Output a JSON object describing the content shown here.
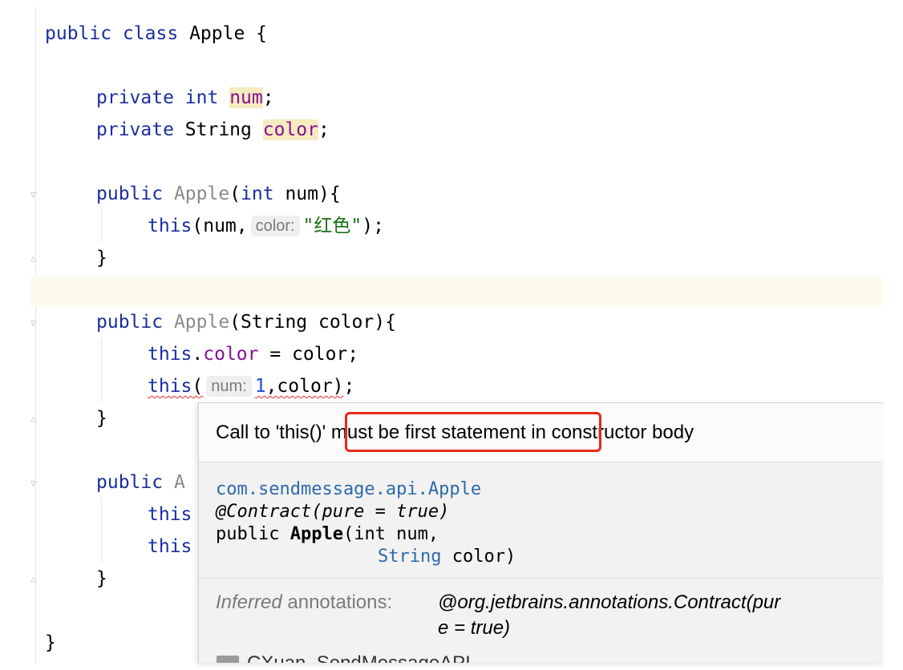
{
  "code": {
    "line1": {
      "kw1": "public",
      "kw2": "class",
      "name": "Apple",
      "brace": "{"
    },
    "line2": {
      "kw1": "private",
      "kw2": "int",
      "field": "num",
      "semi": ";"
    },
    "line3": {
      "kw1": "private",
      "type": "String",
      "field": "color",
      "semi": ";"
    },
    "line4": {
      "kw": "public",
      "name": "Apple",
      "params_open": "(",
      "ptype": "int",
      "pname": " num){"
    },
    "line5": {
      "kw": "this",
      "open": "(num,",
      "hint": "color:",
      "str": "\"红色\"",
      "close": ");"
    },
    "line6": {
      "brace": "}"
    },
    "line7": {
      "kw": "public",
      "name": "Apple",
      "params": "(String color){"
    },
    "line8": {
      "kw": "this",
      "dot": ".",
      "field": "color",
      "rest": " = color;"
    },
    "line9": {
      "kw": "this",
      "open": "(",
      "hint": "num:",
      "num": "1",
      "rest": ",color)",
      "semi": ";"
    },
    "line10": {
      "brace": "}"
    },
    "line11": {
      "kw": "public",
      "partial": "A"
    },
    "line12": {
      "kw": "this"
    },
    "line13": {
      "kw": "this"
    },
    "line14": {
      "brace": "}"
    },
    "line15": {
      "brace": "}"
    }
  },
  "popup": {
    "error_part1": "Call to 'this()",
    "error_part2": "' must be first statement",
    "error_part3": " in constructor body",
    "doc_class": "com.sendmessage.api.Apple",
    "doc_annotation": "@Contract(pure = true)",
    "doc_sig_prefix": "public ",
    "doc_sig_name": "Apple",
    "doc_sig_params": "(int num,",
    "doc_sig_type2": "String",
    "doc_sig_param2": " color)",
    "inferred_label_italic": "Inferred",
    "inferred_label": " annotations:",
    "inferred_value_1": "@org.jetbrains.annotations.Contract(pur",
    "inferred_value_2": "e = true)",
    "module_name": "CXuan_SendMessageAPI"
  }
}
